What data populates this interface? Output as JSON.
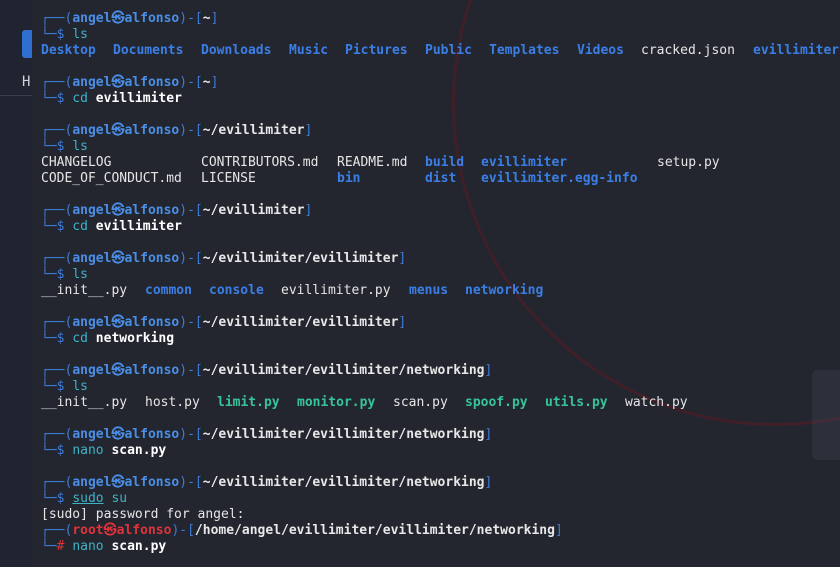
{
  "prompt": {
    "frame_top": "┌──(",
    "frame_bottom": "└─",
    "user": "angel",
    "host": "alfonso",
    "at_symbol": "㉿",
    "bracket_mid": ")-[",
    "bracket_end": "]",
    "dollar": "$",
    "hash": "#",
    "root_user": "root"
  },
  "blocks": [
    {
      "path": "~",
      "cmd": "ls"
    },
    {
      "path": "~",
      "cmd": "cd",
      "arg": "evillimiter"
    },
    {
      "path": "~/evillimiter",
      "cmd": "ls"
    },
    {
      "path": "~/evillimiter",
      "cmd": "cd",
      "arg": "evillimiter"
    },
    {
      "path": "~/evillimiter/evillimiter",
      "cmd": "ls"
    },
    {
      "path": "~/evillimiter/evillimiter",
      "cmd": "cd",
      "arg": "networking"
    },
    {
      "path": "~/evillimiter/evillimiter/networking",
      "cmd": "ls"
    },
    {
      "path": "~/evillimiter/evillimiter/networking",
      "cmd": "nano",
      "arg": "scan.py"
    },
    {
      "path": "~/evillimiter/evillimiter/networking",
      "cmd": "sudo",
      "arg": "su"
    },
    {
      "path": "/home/angel/evillimiter/evillimiter/networking",
      "cmd": "nano",
      "arg": "scan.py"
    }
  ],
  "home_listing": [
    "Desktop",
    "Documents",
    "Downloads",
    "Music",
    "Pictures",
    "Public",
    "Templates",
    "Videos",
    "cracked.json",
    "evillimiter"
  ],
  "repo_listing": {
    "row1": [
      "CHANGELOG",
      "CONTRIBUTORS.md",
      "README.md",
      "build",
      "evillimiter",
      "setup.py"
    ],
    "row2": [
      "CODE_OF_CONDUCT.md",
      "LICENSE",
      "bin",
      "dist",
      "evillimiter.egg-info"
    ]
  },
  "package_listing": [
    "__init__.py",
    "common",
    "console",
    "evillimiter.py",
    "menus",
    "networking"
  ],
  "networking_listing": [
    "__init__.py",
    "host.py",
    "limit.py",
    "monitor.py",
    "scan.py",
    "spoof.py",
    "utils.py",
    "watch.py"
  ],
  "sudo_prompt": "[sudo] password for angel:",
  "left_strip_letter": "H",
  "colors": {
    "terminal_bg": "#23262f",
    "frame_blue": "#3d7bd6",
    "user_blue": "#4a8ee8",
    "root_red": "#e0323a",
    "command_cyan": "#3fb3c6",
    "directory_blue": "#3b7fe6",
    "executable_green": "#37c49a"
  }
}
